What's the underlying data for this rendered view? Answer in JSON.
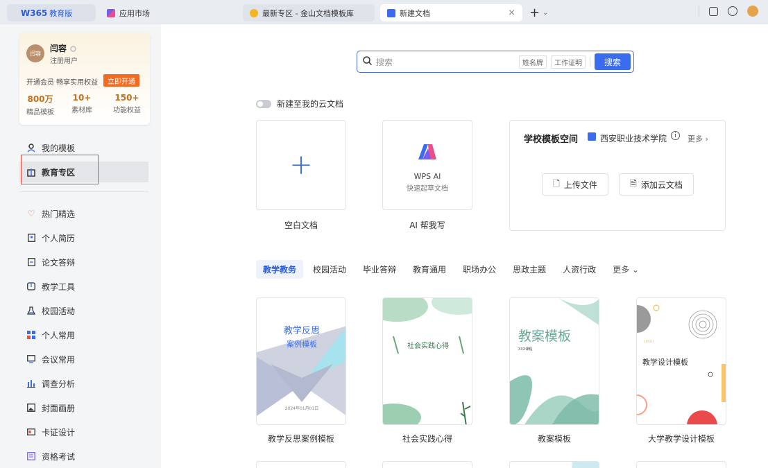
{
  "tabs": {
    "brand_logo": "W365",
    "brand_edu": "教育版",
    "apps": "应用市场",
    "wps_tab": "最新专区 - 金山文档模板库",
    "new_doc": "新建文档",
    "close": "×",
    "plus": "+",
    "chevron": "⌄"
  },
  "member": {
    "avatar_text": "闫容",
    "name": "闫容",
    "role": "注册用户",
    "vip_text": "开通会员 畅享实用权益",
    "vip_button": "立即开通",
    "stats": [
      {
        "num": "800万",
        "label": "精品模板"
      },
      {
        "num": "10+",
        "label": "素材库"
      },
      {
        "num": "150+",
        "label": "功能权益"
      }
    ]
  },
  "nav": {
    "my_templates": "我的模板",
    "education": "教育专区",
    "items": [
      {
        "label": "热门精选",
        "icon": "heart-icon",
        "color": "#e0533a"
      },
      {
        "label": "个人简历",
        "icon": "resume-icon",
        "color": "#333"
      },
      {
        "label": "论文答辩",
        "icon": "thesis-icon",
        "color": "#333"
      },
      {
        "label": "教学工具",
        "icon": "book-icon",
        "color": "#333"
      },
      {
        "label": "校园活动",
        "icon": "flask-icon",
        "color": "#333"
      },
      {
        "label": "个人常用",
        "icon": "grid-icon",
        "color": "#3b6cf0"
      },
      {
        "label": "会议常用",
        "icon": "meeting-icon",
        "color": "#333"
      },
      {
        "label": "调查分析",
        "icon": "bar-chart-icon",
        "color": "#3b6cf0"
      },
      {
        "label": "封面画册",
        "icon": "image-icon",
        "color": "#333"
      },
      {
        "label": "卡证设计",
        "icon": "card-icon",
        "color": "#333"
      },
      {
        "label": "资格考试",
        "icon": "exam-icon",
        "color": "#333"
      }
    ]
  },
  "search": {
    "placeholder": "搜索",
    "chips": [
      "姓名牌",
      "工作证明"
    ],
    "button": "搜索"
  },
  "cloud_toggle": "新建至我的云文档",
  "create": {
    "blank": "空白文档",
    "ai_title": "WPS AI",
    "ai_sub": "快速起草文档",
    "ai_label": "AI 帮我写"
  },
  "school": {
    "title": "学校模板空间",
    "name": "西安职业技术学院",
    "info": "i",
    "more": "更多 ›",
    "upload": "上传文件",
    "add_cloud": "添加云文档"
  },
  "categories": [
    "教学教务",
    "校园活动",
    "毕业答辩",
    "教育通用",
    "职场办公",
    "思政主题",
    "人资行政",
    "更多 ⌄"
  ],
  "templates": [
    {
      "label": "教学反思案例模板",
      "cover": "教学反思",
      "cover2": "案例模板",
      "date": "2024年01月01日"
    },
    {
      "label": "社会实践心得",
      "cover": "社会实践心得"
    },
    {
      "label": "教案模板",
      "cover": "教案模板",
      "cover2": "XXX课程"
    },
    {
      "label": "大学教学设计模板",
      "cover": "教学设计模板",
      "cover2": "LOGO"
    }
  ],
  "colors": {
    "accent": "#3b6cf0",
    "vip": "#f26b23",
    "highlight_box": "#e24a3b"
  }
}
